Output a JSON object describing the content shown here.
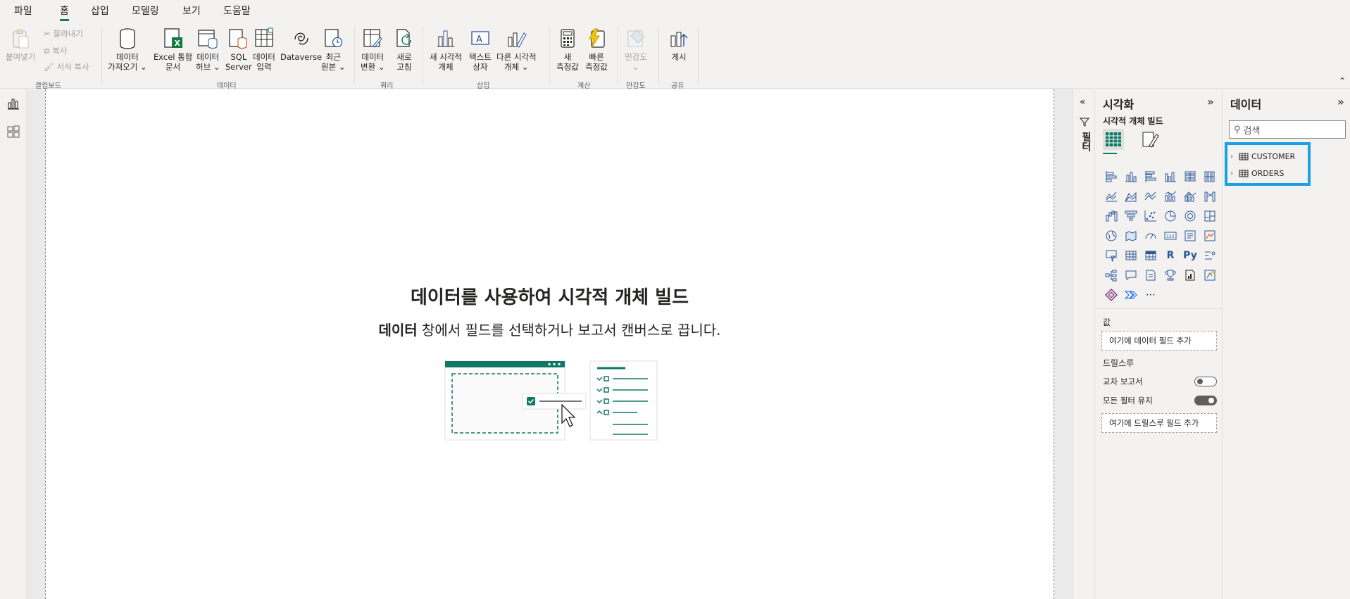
{
  "menu": {
    "tabs": [
      "파일",
      "홈",
      "삽입",
      "모델링",
      "보기",
      "도움말"
    ],
    "active": "홈"
  },
  "ribbon": {
    "clipboard": {
      "paste": "붙여넣기",
      "cut": "잘라내기",
      "copy": "복사",
      "format_copy": "서식 복사",
      "group": "클립보드"
    },
    "data": {
      "get_data_1": "데이터",
      "get_data_2": "가져오기",
      "excel_1": "Excel 통합",
      "excel_2": "문서",
      "hub_1": "데이터",
      "hub_2": "허브",
      "sql_1": "SQL",
      "sql_2": "Server",
      "enter_1": "데이터",
      "enter_2": "입력",
      "dataverse": "Dataverse",
      "recent_1": "최근",
      "recent_2": "원본",
      "group": "데이터"
    },
    "queries": {
      "transform_1": "데이터",
      "transform_2": "변환",
      "refresh_1": "새로",
      "refresh_2": "고침",
      "group": "쿼리"
    },
    "insert": {
      "new_visual_1": "새 시각적",
      "new_visual_2": "개체",
      "textbox_1": "텍스트",
      "textbox_2": "상자",
      "more_visuals_1": "다른 시각적",
      "more_visuals_2": "개체",
      "group": "삽입"
    },
    "calculations": {
      "new_measure_1": "새",
      "new_measure_2": "측정값",
      "quick_measure_1": "빠른",
      "quick_measure_2": "측정값",
      "group": "계산"
    },
    "sensitivity": {
      "label": "민감도",
      "group": "민감도"
    },
    "share": {
      "publish": "게시",
      "group": "공유"
    }
  },
  "canvas": {
    "title": "데이터를 사용하여 시각적 개체 빌드",
    "sub_bold": "데이터",
    "sub_rest": " 창에서 필드를 선택하거나 보고서 캔버스로 끕니다."
  },
  "filters": {
    "label": "필터"
  },
  "visualizations": {
    "title": "시각화",
    "subtitle": "시각적 개체 빌드",
    "values_label": "값",
    "values_placeholder": "여기에 데이터 필드 추가",
    "drillthrough_label": "드릴스루",
    "cross_report": "교차 보고서",
    "cross_report_on": false,
    "keep_filters": "모든 필터 유지",
    "keep_filters_on": true,
    "drill_placeholder": "여기에 드릴스루 필드 추가",
    "more": "⋯",
    "r_label": "R",
    "py_label": "Py"
  },
  "data_pane": {
    "title": "데이터",
    "search_placeholder": "검색",
    "tables": [
      "CUSTOMER",
      "ORDERS"
    ]
  },
  "colors": {
    "accent": "#117865",
    "highlight": "#1ba1e2",
    "icon_blue": "#2b5797"
  }
}
